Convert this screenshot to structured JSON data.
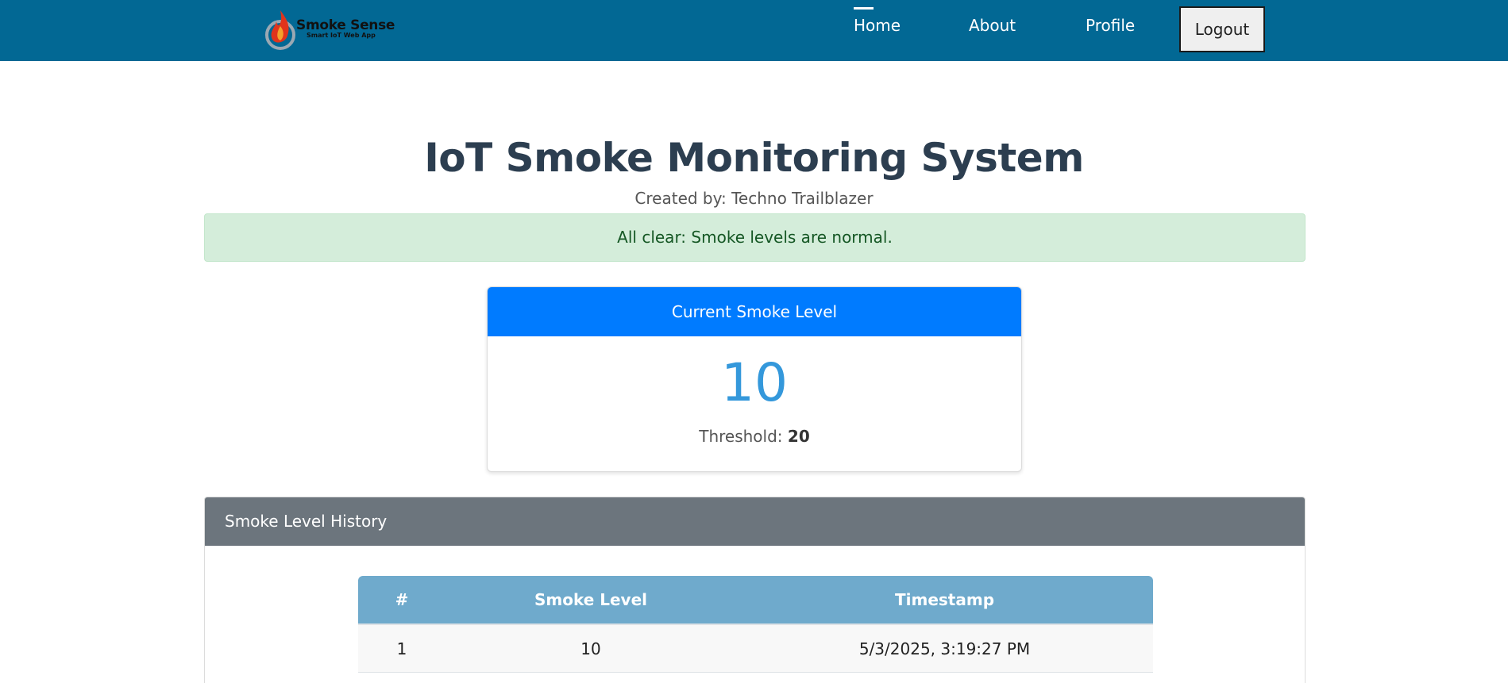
{
  "nav": {
    "logo_title": "Smoke Sense",
    "logo_tagline": "Smart IoT Web App",
    "links": [
      {
        "label": "Home",
        "active": true
      },
      {
        "label": "About",
        "active": false
      },
      {
        "label": "Profile",
        "active": false
      }
    ],
    "logout_label": "Logout",
    "colors": {
      "bar": "#026894",
      "text": "#ffffff"
    }
  },
  "main": {
    "title": "IoT Smoke Monitoring System",
    "subtitle": "Created by: Techno Trailblazer"
  },
  "alert": {
    "message": "All clear: Smoke levels are normal.",
    "status": "success",
    "colors": {
      "background": "#d4edda",
      "text": "#155724"
    }
  },
  "current_level": {
    "header": "Current Smoke Level",
    "value": "10",
    "threshold_label": "Threshold:",
    "threshold_value": "20",
    "colors": {
      "header": "#007bff",
      "value": "#3498db"
    }
  },
  "history": {
    "header": "Smoke Level History",
    "columns": [
      "#",
      "Smoke Level",
      "Timestamp"
    ],
    "rows": [
      [
        "1",
        "10",
        "5/3/2025, 3:19:27 PM"
      ]
    ],
    "colors": {
      "header": "#6c757d",
      "table_head": "#6faacc"
    }
  },
  "icons": [
    "smoke-sense-logo-icon"
  ]
}
